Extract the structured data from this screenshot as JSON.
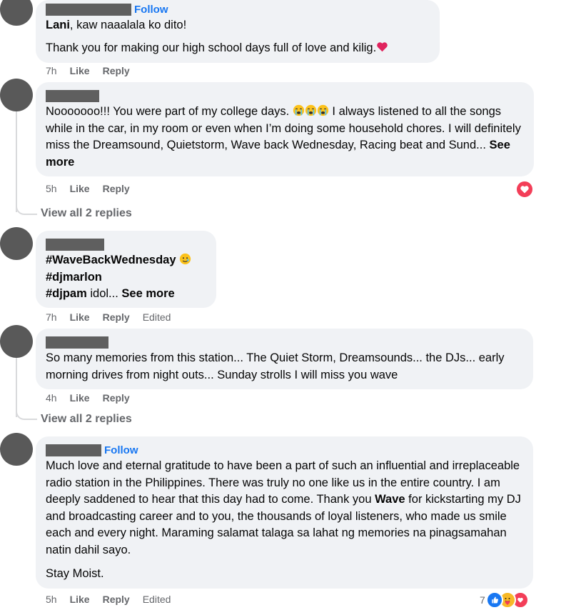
{
  "comments": [
    {
      "follow": "Follow",
      "mention": "Lani",
      "line1_rest": ", kaw naaalala ko dito!",
      "line2": "Thank you for making our high school days full of love and kilig.",
      "time": "7h",
      "like": "Like",
      "reply": "Reply"
    },
    {
      "text_a": "Nooooooo!!! You were part of my college days.",
      "text_b": "I always listened to all the songs while in the car, in my room or even when I’m doing some household chores. I will definitely miss the Dreamsound, Quietstorm, Wave back Wednesday, Racing beat and Sund...",
      "see_more": "See more",
      "time": "5h",
      "like": "Like",
      "reply": "Reply",
      "view_replies": "View all 2 replies"
    },
    {
      "tag1": "#WaveBackWednesday",
      "tag2": "#djmarlon",
      "tag3": "#djpam",
      "tag3_rest": " idol...",
      "see_more": "See more",
      "time": "7h",
      "like": "Like",
      "reply": "Reply",
      "edited": "Edited"
    },
    {
      "text": "So many memories from this station... The Quiet Storm, Dreamsounds... the DJs... early morning drives from night outs... Sunday strolls I will miss you wave",
      "time": "4h",
      "like": "Like",
      "reply": "Reply",
      "view_replies": "View all 2 replies"
    },
    {
      "follow": "Follow",
      "text_a": "Much love and eternal gratitude to have been a part of such an influential and irreplaceable radio station in the Philippines. There was truly no one like us in the entire country. I am deeply saddened to hear that this day had to come. Thank you ",
      "text_bold": "Wave",
      "text_b": " for kickstarting my DJ and broadcasting career and to you, the thousands of loyal listeners, who made us smile each and every night. Maraming salamat talaga sa lahat ng memories na pinagsamahan natin dahil sayo.",
      "line2": "Stay Moist.",
      "time": "5h",
      "like": "Like",
      "reply": "Reply",
      "edited": "Edited",
      "reaction_count": "7"
    }
  ],
  "colors": {
    "bubble": "#f0f2f5",
    "link": "#1877f2",
    "meta": "#65676b",
    "heart": "#f33e58",
    "like_blue": "#1877f2"
  },
  "icons": [
    "heart-emoji",
    "crying-face-emoji",
    "tear-smile-emoji",
    "heart-reaction-icon",
    "like-reaction-icon",
    "care-reaction-icon"
  ]
}
